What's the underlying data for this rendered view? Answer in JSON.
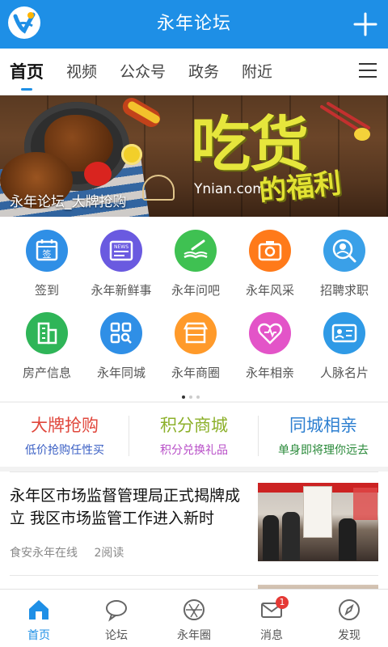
{
  "header": {
    "title": "永年论坛",
    "logo_icon": "app-logo-icon",
    "add_icon": "plus-icon"
  },
  "tabs": [
    {
      "label": "首页",
      "active": true
    },
    {
      "label": "视频"
    },
    {
      "label": "公众号"
    },
    {
      "label": "政务"
    },
    {
      "label": "附近"
    }
  ],
  "tabs_menu_icon": "hamburger-menu-icon",
  "banner": {
    "caption": "永年论坛_大牌抢购",
    "headline": "吃货",
    "subheadline": "的福利",
    "url": "Ynian.com"
  },
  "grid": {
    "items": [
      {
        "label": "签到",
        "icon": "calendar-sign-icon",
        "color": "#2f8fe6"
      },
      {
        "label": "永年新鲜事",
        "icon": "news-icon",
        "color": "#6a5ae0"
      },
      {
        "label": "永年问吧",
        "icon": "book-pen-icon",
        "color": "#3fc152"
      },
      {
        "label": "永年风采",
        "icon": "camera-icon",
        "color": "#ff7a1a"
      },
      {
        "label": "招聘求职",
        "icon": "person-search-icon",
        "color": "#3aa0e8"
      },
      {
        "label": "房产信息",
        "icon": "building-icon",
        "color": "#2fb558"
      },
      {
        "label": "永年同城",
        "icon": "grid-search-icon",
        "color": "#2f8fe6"
      },
      {
        "label": "永年商圈",
        "icon": "shop-icon",
        "color": "#ff9a2a"
      },
      {
        "label": "永年相亲",
        "icon": "heart-icon",
        "color": "#e354c8"
      },
      {
        "label": "人脉名片",
        "icon": "id-card-icon",
        "color": "#2f9ae6"
      }
    ]
  },
  "promos": [
    {
      "title": "大牌抢购",
      "subtitle": "低价抢购任性买",
      "title_color": "#e0473c",
      "subtitle_color": "#3a5fc4"
    },
    {
      "title": "积分商城",
      "subtitle": "积分兑换礼品",
      "title_color": "#8cb02a",
      "subtitle_color": "#b84fc8"
    },
    {
      "title": "同城相亲",
      "subtitle": "单身即将理你远去",
      "title_color": "#2d7fd0",
      "subtitle_color": "#2a8a3a"
    }
  ],
  "news": {
    "headline": "永年区市场监督管理局正式揭牌成立 我区市场监管工作进入新时",
    "source": "食安永年在线",
    "reads": "2阅读"
  },
  "bottom_nav": [
    {
      "label": "首页",
      "icon": "home-icon",
      "active": true
    },
    {
      "label": "论坛",
      "icon": "chat-bubble-icon"
    },
    {
      "label": "永年圈",
      "icon": "aperture-icon"
    },
    {
      "label": "消息",
      "icon": "mail-icon",
      "badge": "1"
    },
    {
      "label": "发现",
      "icon": "compass-icon"
    }
  ],
  "colors": {
    "primary": "#1e8fe6",
    "badge": "#e53935"
  }
}
